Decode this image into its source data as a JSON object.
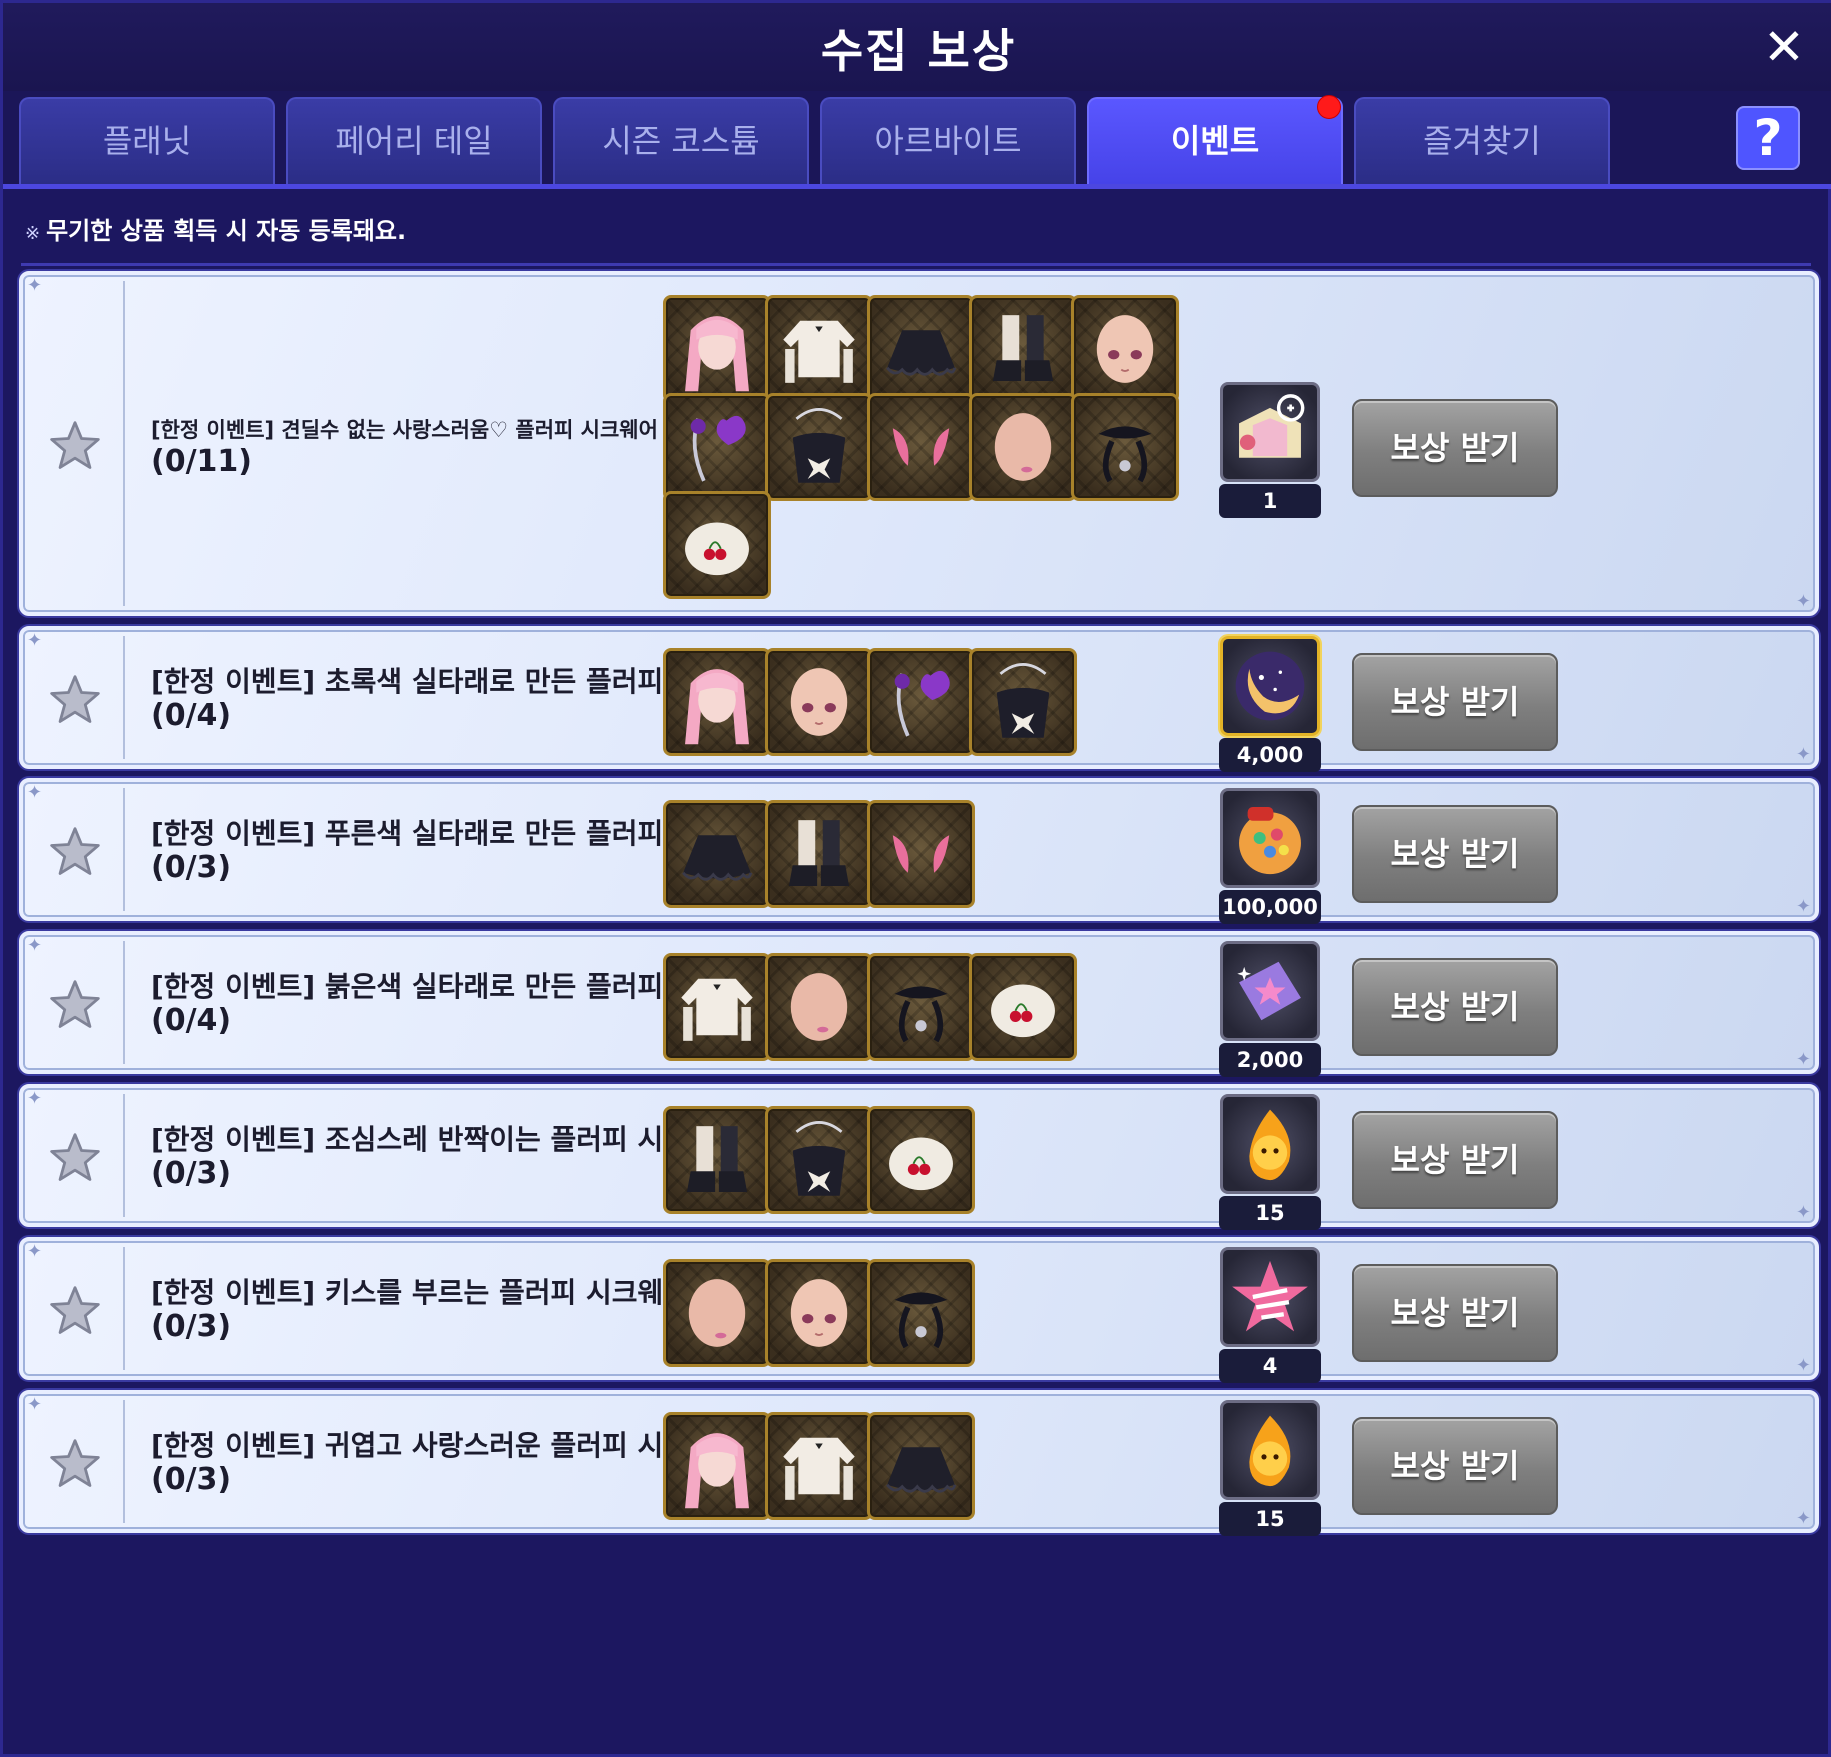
{
  "window": {
    "title": "수집 보상",
    "close": "✕",
    "help": "?"
  },
  "tabs": [
    {
      "label": "플래닛",
      "active": false
    },
    {
      "label": "페어리 테일",
      "active": false
    },
    {
      "label": "시즌 코스튬",
      "active": false
    },
    {
      "label": "아르바이트",
      "active": false
    },
    {
      "label": "이벤트",
      "active": true,
      "notification": true
    },
    {
      "label": "즐겨찾기",
      "active": false
    }
  ],
  "notice": {
    "mark": "※",
    "text": "무기한 상품 획득 시 자동 등록돼요."
  },
  "colors": {
    "accent": "#4f4cf0",
    "frame": "#1c1760",
    "badge": "#ff1a1a",
    "slot_border": "#a8822a"
  },
  "collections": [
    {
      "title": "[한정 이벤트] 견딜수 없는 사랑스러움♡ 플러피 시크웨어 풀 세트",
      "progress": "(0/11)",
      "items": [
        "pink-twintail-hair-icon",
        "white-blouse-icon",
        "black-frill-skirt-icon",
        "black-boots-icon",
        "face-icon",
        "purple-heart-earring-icon",
        "black-ribbon-bag-icon",
        "pink-wings-icon",
        "blush-face-icon",
        "black-choker-icon",
        "cherry-hat-icon"
      ],
      "reward": {
        "icon": "costume-box-icon",
        "count": "1"
      },
      "button": "보상 받기"
    },
    {
      "title": "[한정 이벤트] 초록색 실타래로 만든 플러피 시크웨어",
      "progress": "(0/4)",
      "items": [
        "pink-twintail-hair-icon",
        "face-icon",
        "purple-heart-earring-icon",
        "black-ribbon-bag-icon"
      ],
      "reward": {
        "icon": "moon-orb-icon",
        "count": "4,000"
      },
      "button": "보상 받기"
    },
    {
      "title": "[한정 이벤트] 푸른색 실타래로 만든 플러피 시크웨어",
      "progress": "(0/3)",
      "items": [
        "black-frill-skirt-icon",
        "black-boots-icon",
        "pink-wings-icon"
      ],
      "reward": {
        "icon": "candy-jar-icon",
        "count": "100,000"
      },
      "button": "보상 받기"
    },
    {
      "title": "[한정 이벤트] 붉은색 실타래로 만든 플러피 시크웨어",
      "progress": "(0/4)",
      "items": [
        "white-blouse-icon",
        "blush-face-icon",
        "black-choker-icon",
        "cherry-hat-icon"
      ],
      "reward": {
        "icon": "purple-star-ticket-icon",
        "count": "2,000"
      },
      "button": "보상 받기"
    },
    {
      "title": "[한정 이벤트] 조심스레 반짝이는 플러피 시크웨어",
      "progress": "(0/3)",
      "items": [
        "black-boots-icon",
        "black-ribbon-bag-icon",
        "cherry-hat-icon"
      ],
      "reward": {
        "icon": "fire-spirit-icon",
        "count": "15"
      },
      "button": "보상 받기"
    },
    {
      "title": "[한정 이벤트] 키스를 부르는 플러피 시크웨어",
      "progress": "(0/3)",
      "items": [
        "blush-face-icon",
        "face-icon",
        "black-choker-icon"
      ],
      "reward": {
        "icon": "pink-star-icon",
        "count": "4"
      },
      "button": "보상 받기"
    },
    {
      "title": "[한정 이벤트] 귀엽고 사랑스러운 플러피 시크웨어",
      "progress": "(0/3)",
      "items": [
        "pink-twintail-hair-icon",
        "white-blouse-icon",
        "black-frill-skirt-icon"
      ],
      "reward": {
        "icon": "fire-spirit-icon",
        "count": "15"
      },
      "button": "보상 받기"
    }
  ]
}
